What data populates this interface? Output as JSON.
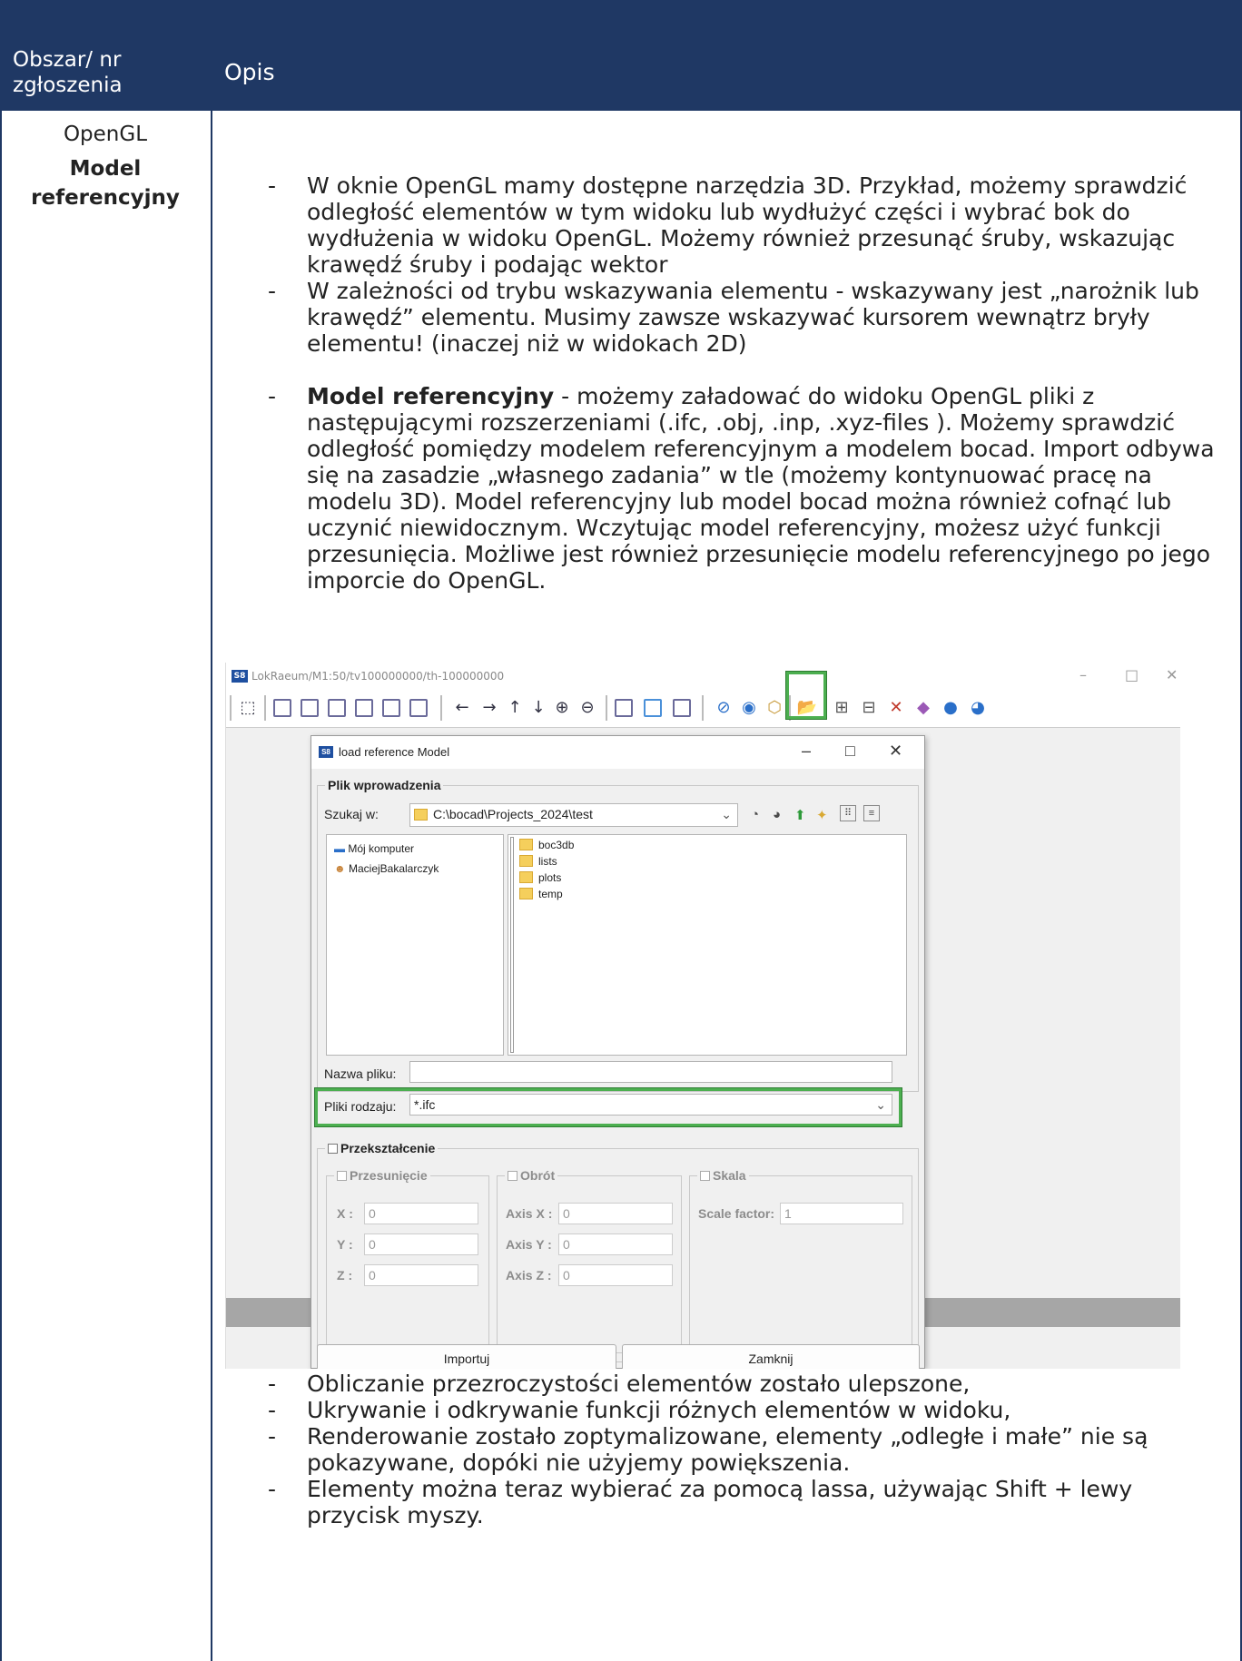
{
  "header": {
    "col1": "Obszar/ nr zgłoszenia",
    "col2": "Opis"
  },
  "area": {
    "line1": "OpenGL",
    "line2": "Model referencyjny"
  },
  "bullets_top": [
    "W oknie OpenGL mamy dostępne narzędzia 3D. Przykład, możemy sprawdzić odległość elementów w tym widoku lub wydłużyć części i wybrać bok do wydłużenia w widoku OpenGL. Możemy również przesunąć śruby, wskazując krawędź śruby i podając wektor",
    "W zależności od trybu wskazywania elementu - wskazywany jest „narożnik lub krawędź” elementu. Musimy zawsze wskazywać kursorem wewnątrz bryły elementu! (inaczej niż w widokach 2D)"
  ],
  "bullet_model": {
    "bold": "Model referencyjny",
    "rest": " - możemy załadować do widoku OpenGL pliki z następującymi rozszerzeniami (.ifc, .obj, .inp, .xyz-files ). Możemy sprawdzić odległość pomiędzy modelem referencyjnym a modelem bocad. Import odbywa się na zasadzie „własnego zadania” w tle (możemy kontynuować pracę na modelu 3D). Model referencyjny lub model bocad można również cofnąć lub uczynić niewidocznym. Wczytując model referencyjny, możesz użyć funkcji przesunięcia. Możliwe jest również przesunięcie modelu referencyjnego po jego imporcie do OpenGL."
  },
  "bullets_bottom": [
    "Obliczanie przezroczystości elementów zostało ulepszone,",
    "Ukrywanie i odkrywanie funkcji różnych elementów w widoku,",
    "Renderowanie zostało zoptymalizowane, elementy „odległe i małe” nie są pokazywane, dopóki nie użyjemy powiększenia.",
    "Elementy można teraz wybierać za pomocą lassa, używając Shift + lewy przycisk myszy."
  ],
  "screenshot": {
    "app_logo": "S8",
    "window_title": "LokRaeum/M1:50/tv100000000/th-100000000",
    "dialog": {
      "title": "load reference Model",
      "group_input": "Plik wprowadzenia",
      "look_in_label": "Szukaj w:",
      "look_in_value": "C:\\bocad\\Projects_2024\\test",
      "places": [
        "Mój komputer",
        "MaciejBakalarczyk"
      ],
      "folders": [
        "boc3db",
        "lists",
        "plots",
        "temp"
      ],
      "filename_label": "Nazwa pliku:",
      "filename_value": "",
      "filetype_label": "Pliki rodzaju:",
      "filetype_value": "*.ifc",
      "transform_label": "Przekształcenie",
      "shift": {
        "label": "Przesunięcie",
        "x_label": "X :",
        "y_label": "Y :",
        "z_label": "Z :",
        "x": "0",
        "y": "0",
        "z": "0"
      },
      "rotation": {
        "label": "Obrót",
        "x_label": "Axis X :",
        "y_label": "Axis Y :",
        "z_label": "Axis Z :",
        "x": "0",
        "y": "0",
        "z": "0"
      },
      "scale": {
        "label": "Skala",
        "factor_label": "Scale factor:",
        "factor": "1"
      },
      "import_button": "Importuj",
      "close_button": "Zamknij"
    }
  }
}
